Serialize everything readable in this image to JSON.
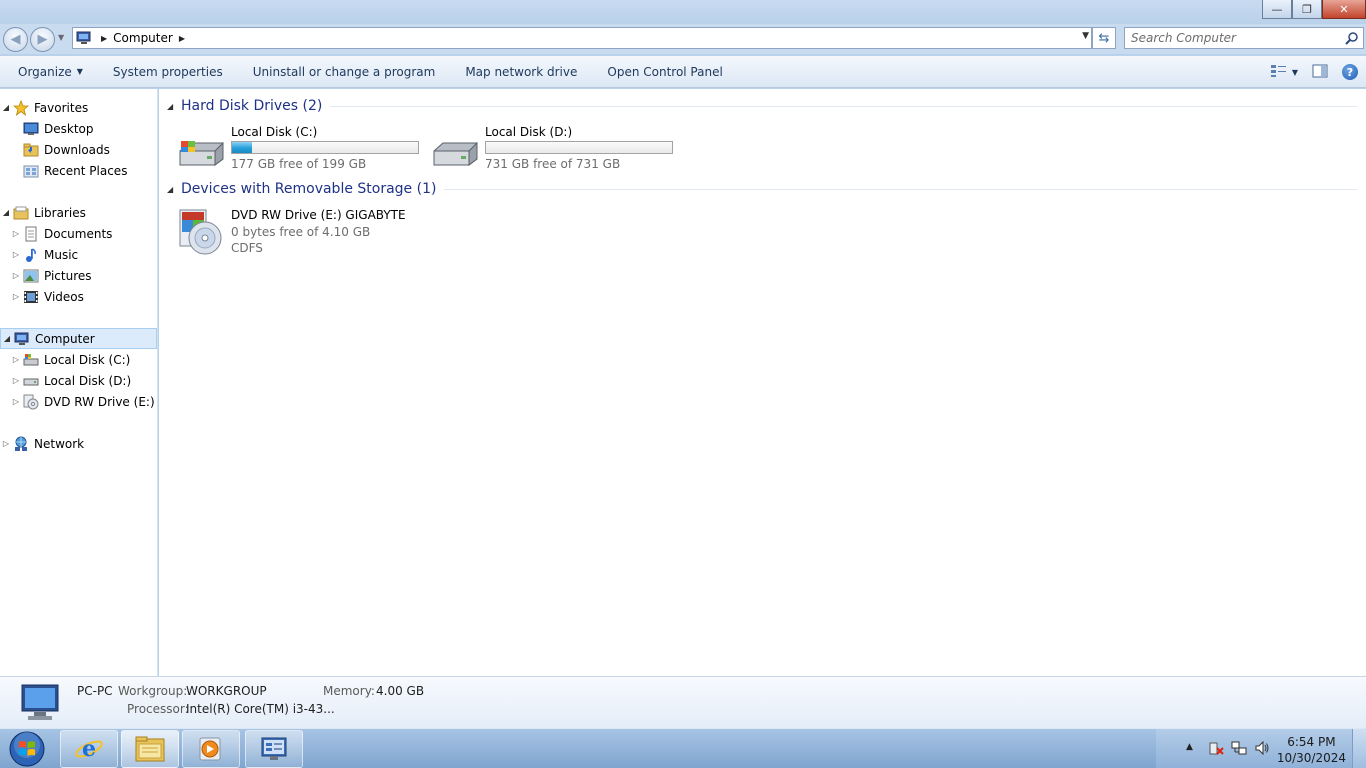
{
  "window": {
    "minimize_label": "—",
    "maximize_label": "❐",
    "close_label": "✕"
  },
  "address": {
    "path": [
      "Computer"
    ],
    "search_placeholder": "Search Computer"
  },
  "toolbar": {
    "organize": "Organize",
    "system_properties": "System properties",
    "uninstall": "Uninstall or change a program",
    "map_network": "Map network drive",
    "open_control_panel": "Open Control Panel"
  },
  "nav": {
    "favorites": "Favorites",
    "desktop": "Desktop",
    "downloads": "Downloads",
    "recent_places": "Recent Places",
    "libraries": "Libraries",
    "documents": "Documents",
    "music": "Music",
    "pictures": "Pictures",
    "videos": "Videos",
    "computer": "Computer",
    "local_c": "Local Disk (C:)",
    "local_d": "Local Disk (D:)",
    "dvd": "DVD RW Drive (E:) GIGABYTE",
    "network": "Network"
  },
  "groups": {
    "hdd": "Hard Disk Drives (2)",
    "removable": "Devices with Removable Storage (1)"
  },
  "drives": [
    {
      "name": "Local Disk (C:)",
      "free": "177 GB free of 199 GB",
      "used_fraction": 0.11
    },
    {
      "name": "Local Disk (D:)",
      "free": "731 GB free of 731 GB",
      "used_fraction": 0.0
    }
  ],
  "dvd": {
    "name": "DVD RW Drive (E:) GIGABYTE",
    "free": "0 bytes free of 4.10 GB",
    "fs": "CDFS"
  },
  "details": {
    "pc_name": "PC-PC",
    "workgroup_label": "Workgroup:",
    "workgroup": "WORKGROUP",
    "memory_label": "Memory:",
    "memory": "4.00 GB",
    "processor_label": "Processor:",
    "processor": "Intel(R) Core(TM) i3-43..."
  },
  "clock": {
    "time": "6:54 PM",
    "date": "10/30/2024"
  },
  "colors": {
    "accent": "#26a0da",
    "group_title": "#1e3287",
    "taskbar": "#8fb1d8"
  }
}
